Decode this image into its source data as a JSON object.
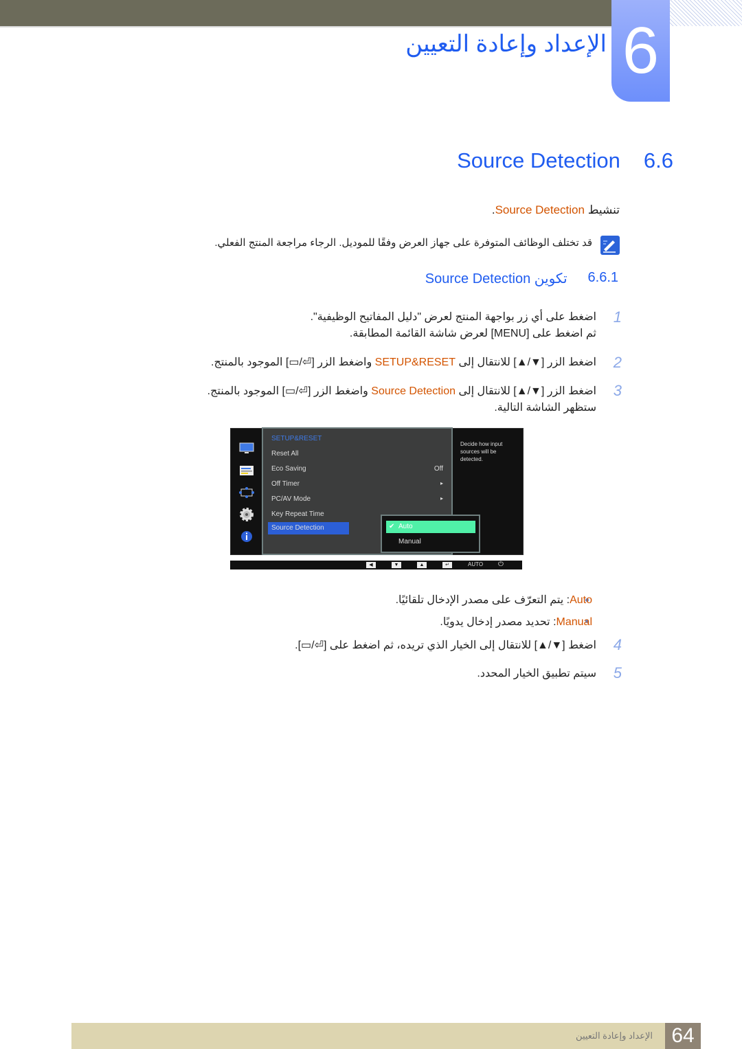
{
  "header": {
    "chapter_number": "6",
    "chapter_title": "الإعداد وإعادة التعيين"
  },
  "section": {
    "number": "6.6",
    "title": "Source Detection"
  },
  "activate": {
    "prefix": "تنشيط ",
    "term": "Source Detection",
    "suffix": "."
  },
  "note": {
    "icon": "note-pencil-icon",
    "text": "قد تختلف الوظائف المتوفرة على جهاز العرض وفقًا للموديل. الرجاء مراجعة المنتج الفعلي."
  },
  "subsection": {
    "number": "6.6.1",
    "title": "تكوين Source Detection"
  },
  "steps": [
    {
      "num": "1",
      "line1": "اضغط على أي زر بواجهة المنتج لعرض \"دليل المفاتيح الوظيفية\".",
      "line2": "ثم اضغط على [MENU] لعرض شاشة القائمة المطابقة."
    },
    {
      "num": "2",
      "pre": "اضغط الزر [▼/▲] للانتقال إلى ",
      "term": "SETUP&RESET",
      "post": " واضغط الزر [⏎/▭] الموجود بالمنتج."
    },
    {
      "num": "3",
      "pre": "اضغط الزر [▼/▲] للانتقال إلى ",
      "term": "Source Detection",
      "post": " واضغط الزر [⏎/▭] الموجود بالمنتج.",
      "line2": "ستظهر الشاشة التالية."
    },
    {
      "num": "4",
      "text": "اضغط [▼/▲] للانتقال إلى الخيار الذي تريده، ثم اضغط على [⏎/▭]."
    },
    {
      "num": "5",
      "text": "سيتم تطبيق الخيار المحدد."
    }
  ],
  "osd": {
    "side_icons": [
      "monitor-icon",
      "picture-settings-icon",
      "position-icon",
      "gear-icon",
      "info-icon"
    ],
    "menu_header": "SETUP&RESET",
    "items": [
      {
        "label": "Reset All",
        "value": ""
      },
      {
        "label": "Eco Saving",
        "value": "Off"
      },
      {
        "label": "Off Timer",
        "value": "▸"
      },
      {
        "label": "PC/AV Mode",
        "value": "▸"
      },
      {
        "label": "Key Repeat Time",
        "value": ""
      },
      {
        "label": "Source Detection",
        "value": "",
        "selected": true
      }
    ],
    "submenu": [
      {
        "label": "Auto",
        "checked": true
      },
      {
        "label": "Manual",
        "checked": false
      }
    ],
    "help_text": "Decide how input sources will be detected.",
    "bottom_bar": [
      "◀",
      "▼",
      "▲",
      "↵",
      "AUTO",
      "⏻"
    ],
    "accent_color": "#3f7ae6",
    "submenu_highlight": "#50f0a8"
  },
  "options": [
    {
      "term": "Auto",
      "desc": ": يتم التعرّف على مصدر الإدخال تلقائيًا."
    },
    {
      "term": "Manual",
      "desc": ": تحديد مصدر إدخال يدويًا."
    }
  ],
  "footer": {
    "page_number": "64",
    "chapter_title": "الإعداد وإعادة التعيين"
  },
  "colors": {
    "heading_blue": "#1f5cf0",
    "term_orange": "#d35400",
    "step_number": "#8ba8e8"
  }
}
